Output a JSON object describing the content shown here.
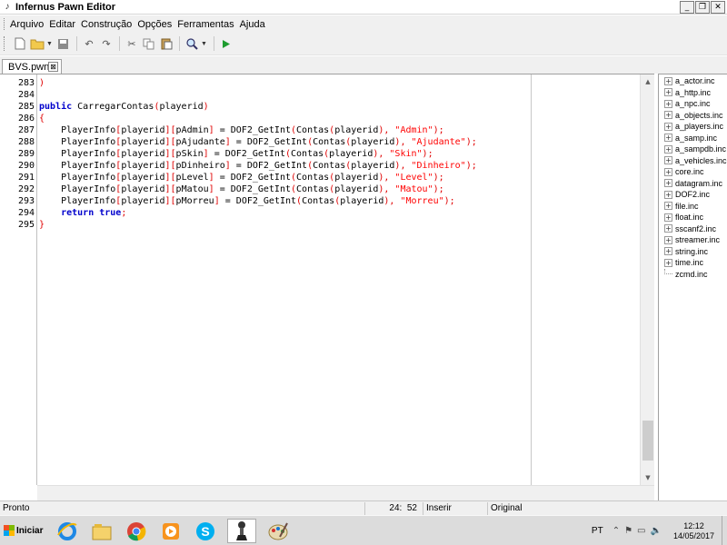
{
  "window": {
    "title": "Infernus Pawn Editor",
    "buttons": {
      "minimize": "_",
      "restore": "❐",
      "close": "✕"
    }
  },
  "menu": [
    "Arquivo",
    "Editar",
    "Construção",
    "Opções",
    "Ferramentas",
    "Ajuda"
  ],
  "toolbar": {
    "icons": [
      "new-file-icon",
      "open-folder-icon",
      "save-icon",
      "undo-icon",
      "redo-icon",
      "cut-icon",
      "copy-icon",
      "paste-icon",
      "find-icon",
      "run-icon"
    ]
  },
  "tabs": [
    {
      "label": "BVS.pwn",
      "close": "⊠"
    }
  ],
  "editor": {
    "line_numbers": [
      "283",
      "284",
      "285",
      "286",
      "287",
      "288",
      "289",
      "290",
      "291",
      "292",
      "293",
      "294",
      "295"
    ],
    "lines": [
      [
        {
          "t": ")",
          "c": "brk"
        }
      ],
      [],
      [
        {
          "t": "public",
          "c": "kw"
        },
        {
          "t": " CarregarContas",
          "c": "id"
        },
        {
          "t": "(",
          "c": "brk"
        },
        {
          "t": "playerid",
          "c": "id"
        },
        {
          "t": ")",
          "c": "brk"
        }
      ],
      [
        {
          "t": "{",
          "c": "brk"
        }
      ],
      [
        {
          "t": "    PlayerInfo",
          "c": "id"
        },
        {
          "t": "[",
          "c": "brk"
        },
        {
          "t": "playerid",
          "c": "id"
        },
        {
          "t": "][",
          "c": "brk"
        },
        {
          "t": "pAdmin",
          "c": "id"
        },
        {
          "t": "]",
          "c": "brk"
        },
        {
          "t": " = DOF2_GetInt",
          "c": "id"
        },
        {
          "t": "(",
          "c": "brk"
        },
        {
          "t": "Contas",
          "c": "id"
        },
        {
          "t": "(",
          "c": "brk"
        },
        {
          "t": "playerid",
          "c": "id"
        },
        {
          "t": "),",
          "c": "brk"
        },
        {
          "t": " \"Admin\"",
          "c": "str"
        },
        {
          "t": ");",
          "c": "brk"
        }
      ],
      [
        {
          "t": "    PlayerInfo",
          "c": "id"
        },
        {
          "t": "[",
          "c": "brk"
        },
        {
          "t": "playerid",
          "c": "id"
        },
        {
          "t": "][",
          "c": "brk"
        },
        {
          "t": "pAjudante",
          "c": "id"
        },
        {
          "t": "]",
          "c": "brk"
        },
        {
          "t": " = DOF2_GetInt",
          "c": "id"
        },
        {
          "t": "(",
          "c": "brk"
        },
        {
          "t": "Contas",
          "c": "id"
        },
        {
          "t": "(",
          "c": "brk"
        },
        {
          "t": "playerid",
          "c": "id"
        },
        {
          "t": "),",
          "c": "brk"
        },
        {
          "t": " \"Ajudante\"",
          "c": "str"
        },
        {
          "t": ");",
          "c": "brk"
        }
      ],
      [
        {
          "t": "    PlayerInfo",
          "c": "id"
        },
        {
          "t": "[",
          "c": "brk"
        },
        {
          "t": "playerid",
          "c": "id"
        },
        {
          "t": "][",
          "c": "brk"
        },
        {
          "t": "pSkin",
          "c": "id"
        },
        {
          "t": "]",
          "c": "brk"
        },
        {
          "t": " = DOF2_GetInt",
          "c": "id"
        },
        {
          "t": "(",
          "c": "brk"
        },
        {
          "t": "Contas",
          "c": "id"
        },
        {
          "t": "(",
          "c": "brk"
        },
        {
          "t": "playerid",
          "c": "id"
        },
        {
          "t": "),",
          "c": "brk"
        },
        {
          "t": " \"Skin\"",
          "c": "str"
        },
        {
          "t": ");",
          "c": "brk"
        }
      ],
      [
        {
          "t": "    PlayerInfo",
          "c": "id"
        },
        {
          "t": "[",
          "c": "brk"
        },
        {
          "t": "playerid",
          "c": "id"
        },
        {
          "t": "][",
          "c": "brk"
        },
        {
          "t": "pDinheiro",
          "c": "id"
        },
        {
          "t": "]",
          "c": "brk"
        },
        {
          "t": " = DOF2_GetInt",
          "c": "id"
        },
        {
          "t": "(",
          "c": "brk"
        },
        {
          "t": "Contas",
          "c": "id"
        },
        {
          "t": "(",
          "c": "brk"
        },
        {
          "t": "playerid",
          "c": "id"
        },
        {
          "t": "),",
          "c": "brk"
        },
        {
          "t": " \"Dinheiro\"",
          "c": "str"
        },
        {
          "t": ");",
          "c": "brk"
        }
      ],
      [
        {
          "t": "    PlayerInfo",
          "c": "id"
        },
        {
          "t": "[",
          "c": "brk"
        },
        {
          "t": "playerid",
          "c": "id"
        },
        {
          "t": "][",
          "c": "brk"
        },
        {
          "t": "pLevel",
          "c": "id"
        },
        {
          "t": "]",
          "c": "brk"
        },
        {
          "t": " = DOF2_GetInt",
          "c": "id"
        },
        {
          "t": "(",
          "c": "brk"
        },
        {
          "t": "Contas",
          "c": "id"
        },
        {
          "t": "(",
          "c": "brk"
        },
        {
          "t": "playerid",
          "c": "id"
        },
        {
          "t": "),",
          "c": "brk"
        },
        {
          "t": " \"Level\"",
          "c": "str"
        },
        {
          "t": ");",
          "c": "brk"
        }
      ],
      [
        {
          "t": "    PlayerInfo",
          "c": "id"
        },
        {
          "t": "[",
          "c": "brk"
        },
        {
          "t": "playerid",
          "c": "id"
        },
        {
          "t": "][",
          "c": "brk"
        },
        {
          "t": "pMatou",
          "c": "id"
        },
        {
          "t": "]",
          "c": "brk"
        },
        {
          "t": " = DOF2_GetInt",
          "c": "id"
        },
        {
          "t": "(",
          "c": "brk"
        },
        {
          "t": "Contas",
          "c": "id"
        },
        {
          "t": "(",
          "c": "brk"
        },
        {
          "t": "playerid",
          "c": "id"
        },
        {
          "t": "),",
          "c": "brk"
        },
        {
          "t": " \"Matou\"",
          "c": "str"
        },
        {
          "t": ");",
          "c": "brk"
        }
      ],
      [
        {
          "t": "    PlayerInfo",
          "c": "id"
        },
        {
          "t": "[",
          "c": "brk"
        },
        {
          "t": "playerid",
          "c": "id"
        },
        {
          "t": "][",
          "c": "brk"
        },
        {
          "t": "pMorreu",
          "c": "id"
        },
        {
          "t": "]",
          "c": "brk"
        },
        {
          "t": " = DOF2_GetInt",
          "c": "id"
        },
        {
          "t": "(",
          "c": "brk"
        },
        {
          "t": "Contas",
          "c": "id"
        },
        {
          "t": "(",
          "c": "brk"
        },
        {
          "t": "playerid",
          "c": "id"
        },
        {
          "t": "),",
          "c": "brk"
        },
        {
          "t": " \"Morreu\"",
          "c": "str"
        },
        {
          "t": ");",
          "c": "brk"
        }
      ],
      [
        {
          "t": "    ",
          "c": "id"
        },
        {
          "t": "return true",
          "c": "kw"
        },
        {
          "t": ";",
          "c": "brk"
        }
      ],
      [
        {
          "t": "}",
          "c": "brk"
        }
      ]
    ]
  },
  "includes": [
    {
      "label": "a_actor.inc",
      "expandable": true
    },
    {
      "label": "a_http.inc",
      "expandable": true
    },
    {
      "label": "a_npc.inc",
      "expandable": true
    },
    {
      "label": "a_objects.inc",
      "expandable": true
    },
    {
      "label": "a_players.inc",
      "expandable": true
    },
    {
      "label": "a_samp.inc",
      "expandable": true
    },
    {
      "label": "a_sampdb.inc",
      "expandable": true
    },
    {
      "label": "a_vehicles.inc",
      "expandable": true
    },
    {
      "label": "core.inc",
      "expandable": true
    },
    {
      "label": "datagram.inc",
      "expandable": true
    },
    {
      "label": "DOF2.inc",
      "expandable": true
    },
    {
      "label": "file.inc",
      "expandable": true
    },
    {
      "label": "float.inc",
      "expandable": true
    },
    {
      "label": "sscanf2.inc",
      "expandable": true
    },
    {
      "label": "streamer.inc",
      "expandable": true
    },
    {
      "label": "string.inc",
      "expandable": true
    },
    {
      "label": "time.inc",
      "expandable": true
    },
    {
      "label": "zcmd.inc",
      "expandable": false
    }
  ],
  "status": {
    "state": "Pronto",
    "line": "24",
    "column": "52",
    "mode": "Inserir",
    "encoding": "Original"
  },
  "taskbar": {
    "start_label": "Iniciar",
    "apps": [
      "ie-icon",
      "explorer-icon",
      "chrome-icon",
      "media-player-icon",
      "skype-icon",
      "pawn-editor-icon",
      "paint-icon"
    ],
    "language": "PT",
    "time": "12:12",
    "date": "14/05/2017"
  },
  "colors": {
    "keyword": "#0000cc",
    "string": "#ff0000",
    "bracket": "#e00000"
  }
}
